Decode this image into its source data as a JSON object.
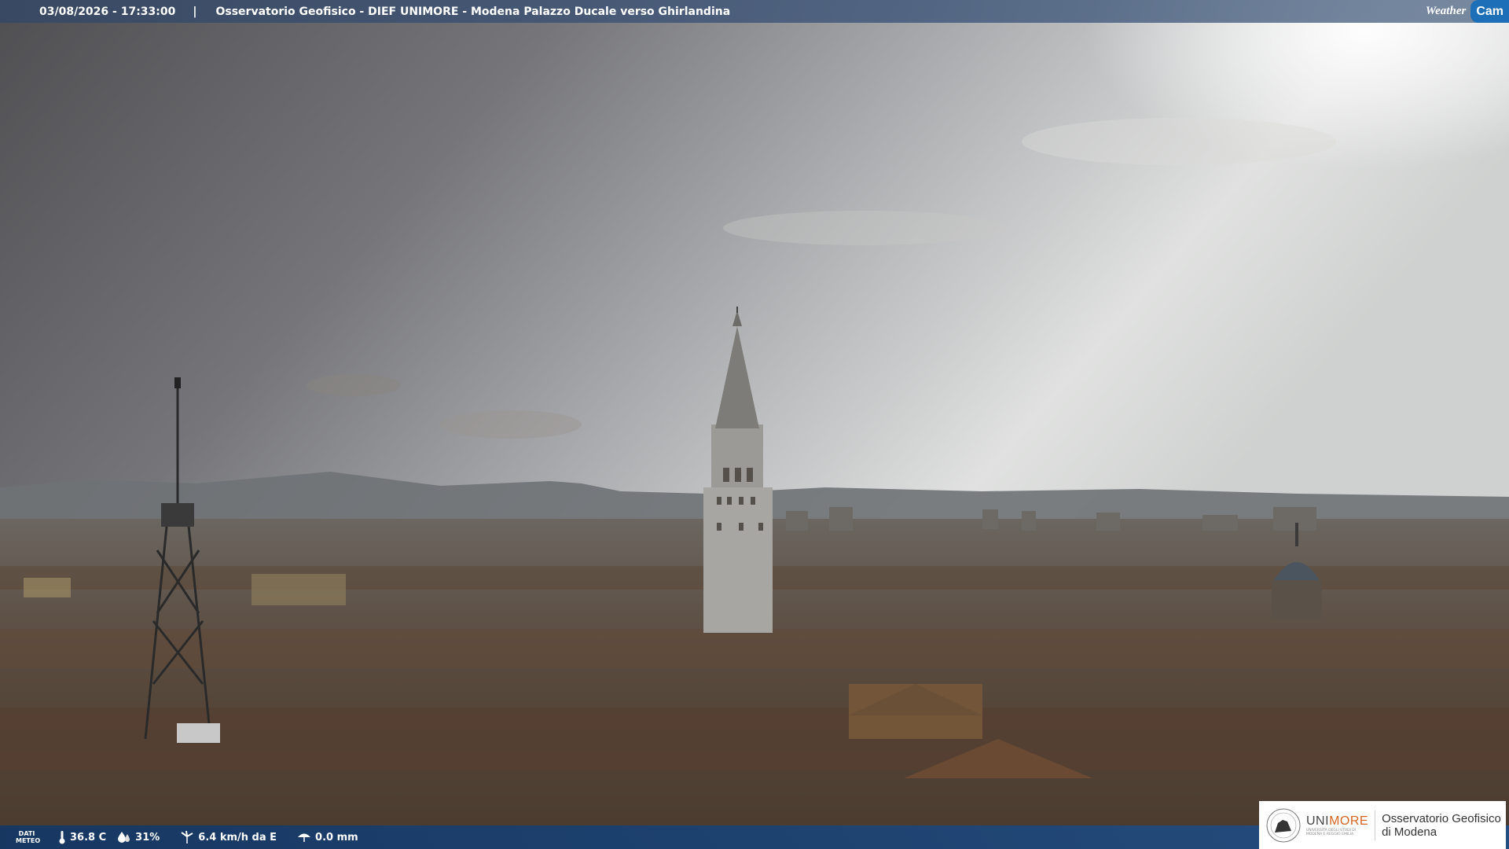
{
  "overlay": {
    "timestamp": "03/08/2026 - 17:33:00",
    "separator": "|",
    "title": "Osservatorio Geofisico - DIEF UNIMORE - Modena Palazzo Ducale verso Ghirlandina"
  },
  "brand": {
    "weather": "Weather",
    "cam": "Cam"
  },
  "meteo": {
    "label_line1": "DATI",
    "label_line2": "METEO",
    "temperature": "36.8 C",
    "humidity": "31%",
    "wind": "6.4 km/h da E",
    "rain": "0.0 mm"
  },
  "institution": {
    "name_prefix": "UNI",
    "name_suffix": "MORE",
    "subtitle": "UNIVERSITÀ DEGLI STUDI DI MODENA E REGGIO EMILIA",
    "observatory_line1": "Osservatorio Geofisico",
    "observatory_line2": "di Modena"
  },
  "colors": {
    "bar": "#2a4e80",
    "accent": "#1d6fb8",
    "unimore_orange": "#d4651e"
  },
  "icons": [
    "thermometer-icon",
    "humidity-drop-icon",
    "wind-icon",
    "rain-umbrella-icon",
    "university-seal-icon"
  ]
}
